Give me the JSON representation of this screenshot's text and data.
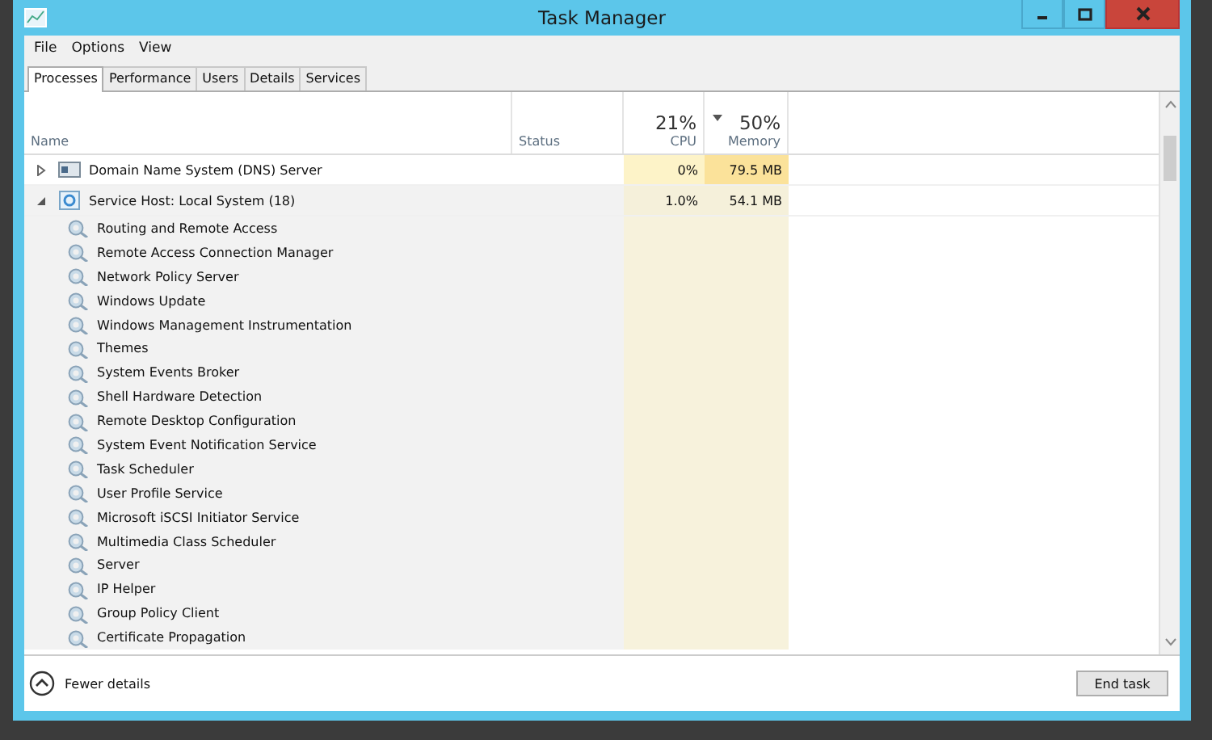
{
  "window": {
    "title": "Task Manager"
  },
  "menu": [
    "File",
    "Options",
    "View"
  ],
  "tabs": [
    {
      "label": "Processes",
      "selected": true
    },
    {
      "label": "Performance",
      "selected": false
    },
    {
      "label": "Users",
      "selected": false
    },
    {
      "label": "Details",
      "selected": false
    },
    {
      "label": "Services",
      "selected": false
    }
  ],
  "columns": [
    {
      "kind": "name",
      "label": "Name"
    },
    {
      "kind": "status",
      "label": "Status"
    },
    {
      "kind": "cpu",
      "total": "21%",
      "label": "CPU"
    },
    {
      "kind": "memory",
      "total": "50%",
      "label": "Memory",
      "sorted": true
    }
  ],
  "processes": [
    {
      "kind": "app",
      "name": "Domain Name System (DNS) Server",
      "expanded": false,
      "selected": false,
      "cpu": "0%",
      "memory": "79.5 MB"
    },
    {
      "kind": "host",
      "name": "Service Host: Local System (18)",
      "expanded": true,
      "selected": true,
      "cpu": "1.0%",
      "memory": "54.1 MB",
      "children": [
        {
          "name": "Routing and Remote Access"
        },
        {
          "name": "Remote Access Connection Manager"
        },
        {
          "name": "Network Policy Server"
        },
        {
          "name": "Windows Update"
        },
        {
          "name": "Windows Management Instrumentation"
        },
        {
          "name": "Themes"
        },
        {
          "name": "System Events Broker"
        },
        {
          "name": "Shell Hardware Detection"
        },
        {
          "name": "Remote Desktop Configuration"
        },
        {
          "name": "System Event Notification Service"
        },
        {
          "name": "Task Scheduler"
        },
        {
          "name": "User Profile Service"
        },
        {
          "name": "Microsoft iSCSI Initiator Service"
        },
        {
          "name": "Multimedia Class Scheduler"
        },
        {
          "name": "Server"
        },
        {
          "name": "IP Helper"
        },
        {
          "name": "Group Policy Client"
        },
        {
          "name": "Certificate Propagation"
        }
      ]
    }
  ],
  "footer": {
    "details_link": "Fewer details",
    "end_button": "End task"
  }
}
